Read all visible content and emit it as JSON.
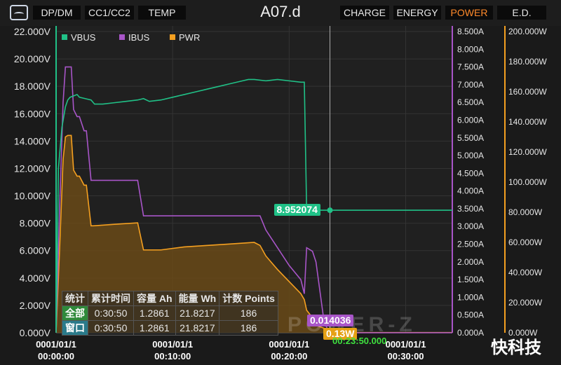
{
  "toolbar": {
    "tabs": [
      "DP/DM",
      "CC1/CC2",
      "TEMP"
    ],
    "title": "A07.d",
    "right_tabs": [
      "CHARGE",
      "ENERGY",
      "POWER",
      "E.D."
    ],
    "active": "POWER"
  },
  "colors": {
    "vbus": "#20c187",
    "ibus": "#a855c8",
    "pwr": "#f5a020",
    "pwr_fill": "#6a4a18"
  },
  "chart_data": {
    "type": "line",
    "legend": [
      "VBUS",
      "IBUS",
      "PWR"
    ],
    "legend_position": "top-left",
    "x_tick_labels": [
      [
        "0001/01/1",
        "00:00:00"
      ],
      [
        "0001/01/1",
        "00:10:00"
      ],
      [
        "0001/01/1",
        "00:20:00"
      ],
      [
        "0001/01/1",
        "00:30:00"
      ]
    ],
    "x_range_min": [
      0,
      34
    ],
    "y_left": {
      "range": [
        0,
        22
      ],
      "ticks": [
        "0.000V",
        "2.000V",
        "4.000V",
        "6.000V",
        "8.000V",
        "10.000V",
        "12.000V",
        "14.000V",
        "16.000V",
        "18.000V",
        "20.000V",
        "22.000V"
      ]
    },
    "y_mid": {
      "range": [
        0,
        8.5
      ],
      "ticks": [
        "0.000A",
        "0.500A",
        "1.000A",
        "1.500A",
        "2.000A",
        "2.500A",
        "3.000A",
        "3.500A",
        "4.000A",
        "4.500A",
        "5.000A",
        "5.500A",
        "6.000A",
        "6.500A",
        "7.000A",
        "7.500A",
        "8.000A",
        "8.500A"
      ]
    },
    "y_right": {
      "range": [
        0,
        200
      ],
      "ticks": [
        "0.000W",
        "20.000W",
        "40.000W",
        "60.000W",
        "80.000W",
        "100.000W",
        "120.000W",
        "140.000W",
        "160.000W",
        "180.000W",
        "200.000W"
      ]
    },
    "series": [
      {
        "name": "VBUS",
        "unit": "V",
        "x": [
          0,
          0.2,
          0.5,
          0.8,
          1,
          1.2,
          1.5,
          1.8,
          2,
          2.5,
          3,
          3.3,
          4,
          5,
          6,
          7,
          7.5,
          8,
          9,
          10,
          11,
          12,
          13,
          14,
          15,
          16,
          16.5,
          17,
          18,
          19,
          20,
          21,
          21.3,
          21.5,
          23,
          25,
          30,
          31,
          31.5,
          34
        ],
        "y": [
          0,
          12,
          15,
          16.5,
          17,
          17.2,
          17.3,
          17.4,
          17.2,
          17.1,
          17.0,
          16.7,
          16.7,
          16.8,
          16.9,
          17.0,
          17.1,
          16.9,
          17.0,
          17.2,
          17.4,
          17.6,
          17.8,
          18.0,
          18.2,
          18.4,
          18.5,
          18.5,
          18.4,
          18.5,
          18.4,
          18.3,
          18.3,
          8.95,
          8.95,
          8.95,
          8.95,
          8.95,
          8.95,
          8.95
        ]
      },
      {
        "name": "IBUS",
        "unit": "A",
        "x": [
          0,
          0.3,
          0.6,
          0.8,
          1,
          1.3,
          1.5,
          1.8,
          2,
          2.4,
          2.6,
          3,
          3.2,
          5,
          7,
          7.5,
          9,
          11,
          13,
          15,
          17,
          17.5,
          18,
          19,
          20,
          21,
          21.3,
          21.5,
          22,
          22.3,
          23,
          23.3,
          23.5,
          34
        ],
        "y": [
          0,
          3.5,
          6.5,
          7.5,
          7.5,
          7.5,
          6.3,
          6.1,
          6.1,
          5.7,
          5.7,
          4.3,
          4.3,
          4.3,
          4.3,
          3.3,
          3.3,
          3.3,
          3.3,
          3.3,
          3.3,
          3.3,
          2.9,
          2.4,
          1.9,
          1.5,
          1.1,
          2.4,
          2.3,
          2.0,
          0.3,
          0.1,
          0,
          0
        ]
      },
      {
        "name": "PWR",
        "unit": "W",
        "x": [
          0,
          0.3,
          0.6,
          0.8,
          1,
          1.3,
          1.5,
          1.8,
          2,
          2.4,
          2.6,
          3,
          3.2,
          5,
          7,
          7.5,
          9,
          11,
          13,
          15,
          17,
          17.5,
          18,
          19,
          20,
          21,
          21.3,
          21.5,
          22,
          22.3,
          23,
          23.3,
          23.5,
          34
        ],
        "y": [
          0,
          55,
          115,
          130,
          131,
          131,
          108,
          104,
          104,
          98,
          98,
          71,
          71,
          72,
          73,
          55,
          55,
          57,
          58,
          59,
          60,
          58,
          51,
          42,
          34,
          26,
          22,
          15,
          10,
          5,
          3,
          1,
          0.13,
          0.13
        ]
      }
    ],
    "cursor": {
      "x": 23.5,
      "vbus_label": "8.952074",
      "ibus_label": "0.014036",
      "pwr_label": "0.13W",
      "time_label": "00:23:50.000"
    }
  },
  "stats_table": {
    "headers": [
      "统计",
      "累计时间",
      "容量 Ah",
      "能量 Wh",
      "计数 Points"
    ],
    "rows": [
      [
        "全部",
        "0:30:50",
        "1.2861",
        "21.8217",
        "186"
      ],
      [
        "窗口",
        "0:30:50",
        "1.2861",
        "21.8217",
        "186"
      ]
    ]
  },
  "watermark": "POWER-Z",
  "brand": "快科技"
}
